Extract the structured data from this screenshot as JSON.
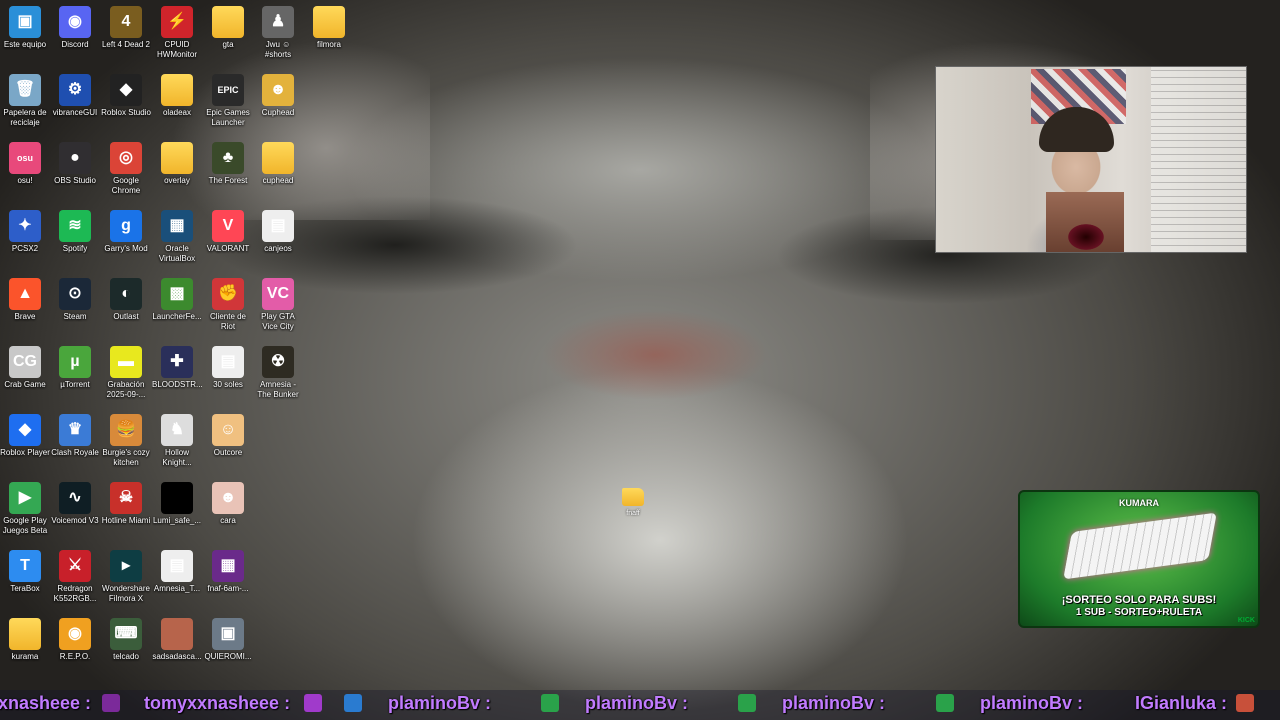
{
  "desktop": {
    "icons": [
      {
        "label": "Este equipo",
        "glyph": "▣",
        "color": "#2a8fd8"
      },
      {
        "label": "Discord",
        "glyph": "◉",
        "color": "#5865f2"
      },
      {
        "label": "Left 4 Dead 2",
        "glyph": "4",
        "color": "#7a5d1f"
      },
      {
        "label": "CPUID HWMonitor",
        "glyph": "⚡",
        "color": "#d0242b"
      },
      {
        "label": "gta",
        "glyph": "",
        "color": "folder"
      },
      {
        "label": "Jwu ☺ #shorts",
        "glyph": "♟",
        "color": "#666"
      },
      {
        "label": "filmora",
        "glyph": "",
        "color": "folder"
      },
      {
        "label": "Papelera de reciclaje",
        "glyph": "🗑",
        "color": "#7aa7c7"
      },
      {
        "label": "vibranceGUI",
        "glyph": "⚙",
        "color": "#1f4fb0"
      },
      {
        "label": "Roblox Studio",
        "glyph": "◆",
        "color": "#222"
      },
      {
        "label": "oladeax",
        "glyph": "",
        "color": "folder"
      },
      {
        "label": "Epic Games Launcher",
        "glyph": "EPIC",
        "color": "#2a2a2a"
      },
      {
        "label": "Cuphead",
        "glyph": "☻",
        "color": "#e3b23c"
      },
      {
        "label": "osu!",
        "glyph": "osu",
        "color": "#e8497b"
      },
      {
        "label": "OBS Studio",
        "glyph": "●",
        "color": "#302e31"
      },
      {
        "label": "Google Chrome",
        "glyph": "◎",
        "color": "#db4437"
      },
      {
        "label": "overlay",
        "glyph": "",
        "color": "folder"
      },
      {
        "label": "The Forest",
        "glyph": "♣",
        "color": "#3a4a2a"
      },
      {
        "label": "cuphead",
        "glyph": "",
        "color": "folder"
      },
      {
        "label": "PCSX2",
        "glyph": "✦",
        "color": "#2d5ec9"
      },
      {
        "label": "Spotify",
        "glyph": "≋",
        "color": "#1db954"
      },
      {
        "label": "Garry's Mod",
        "glyph": "g",
        "color": "#1a73e8"
      },
      {
        "label": "Oracle VirtualBox",
        "glyph": "▦",
        "color": "#1a4f7a"
      },
      {
        "label": "VALORANT",
        "glyph": "V",
        "color": "#ff4655"
      },
      {
        "label": "canjeos",
        "glyph": "▤",
        "color": "#eeeeee"
      },
      {
        "label": "Brave",
        "glyph": "▲",
        "color": "#fb542b"
      },
      {
        "label": "Steam",
        "glyph": "⊙",
        "color": "#1b2838"
      },
      {
        "label": "Outlast",
        "glyph": "◐",
        "color": "#1c2a2a"
      },
      {
        "label": "LauncherFe...",
        "glyph": "▩",
        "color": "#3c8a2e"
      },
      {
        "label": "Cliente de Riot",
        "glyph": "✊",
        "color": "#d13639"
      },
      {
        "label": "Play GTA Vice City",
        "glyph": "VC",
        "color": "#e35ca8"
      },
      {
        "label": "Crab Game",
        "glyph": "CG",
        "color": "#c8c8c8"
      },
      {
        "label": "µTorrent",
        "glyph": "µ",
        "color": "#4aa63c"
      },
      {
        "label": "Grabación 2025-09-...",
        "glyph": "▬",
        "color": "#e8e81e"
      },
      {
        "label": "BLOODSTR...",
        "glyph": "✚",
        "color": "#2a2f5a"
      },
      {
        "label": "30 soles",
        "glyph": "▤",
        "color": "#eeeeee"
      },
      {
        "label": "Amnesia - The Bunker",
        "glyph": "☢",
        "color": "#2e2b22"
      },
      {
        "label": "Roblox Player",
        "glyph": "◆",
        "color": "#1e6ef0"
      },
      {
        "label": "Clash Royale",
        "glyph": "♛",
        "color": "#3b7bd6"
      },
      {
        "label": "Burgie's cozy kitchen",
        "glyph": "🍔",
        "color": "#d88a3a"
      },
      {
        "label": "Hollow Knight...",
        "glyph": "♞",
        "color": "#ddd"
      },
      {
        "label": "Outcore",
        "glyph": "☺",
        "color": "#f0c080"
      },
      {
        "label": "Google Play Juegos Beta",
        "glyph": "▶",
        "color": "#34a853"
      },
      {
        "label": "Voicemod V3",
        "glyph": "∿",
        "color": "#0f1e24"
      },
      {
        "label": "Hotline Miami",
        "glyph": "☠",
        "color": "#c8302a"
      },
      {
        "label": "Lumi_safe_...",
        "glyph": "",
        "color": "#000000"
      },
      {
        "label": "cara",
        "glyph": "☻",
        "color": "#e9c3b7"
      },
      {
        "label": "TeraBox",
        "glyph": "T",
        "color": "#2d8cf0"
      },
      {
        "label": "Redragon K552RGB...",
        "glyph": "⚔",
        "color": "#c8202a"
      },
      {
        "label": "Wondershare Filmora X",
        "glyph": "▸",
        "color": "#0e3d43"
      },
      {
        "label": "Amnesia_T...",
        "glyph": "▤",
        "color": "#eeeeee"
      },
      {
        "label": "fnaf-6am-...",
        "glyph": "▦",
        "color": "#6a2a8a"
      },
      {
        "label": "kurama",
        "glyph": "",
        "color": "folder"
      },
      {
        "label": "R.E.P.O.",
        "glyph": "◉",
        "color": "#f0a020"
      },
      {
        "label": "telcado",
        "glyph": "⌨",
        "color": "#3b5d3b"
      },
      {
        "label": "sadsadasca...",
        "glyph": "",
        "color": "#b7644b"
      },
      {
        "label": "QUIEROMI...",
        "glyph": "▣",
        "color": "#6c7a88"
      }
    ],
    "center_folder": {
      "label": "fnaff"
    }
  },
  "ad": {
    "brand": "KUMARA",
    "line1": "¡SORTEO SOLO PARA SUBS!",
    "line2": "1 SUB - SORTEO+RULETA",
    "corner": "KICK"
  },
  "ticker": {
    "items": [
      {
        "text": "xnasheee :"
      },
      {
        "text": "tomyxxnasheee :"
      },
      {
        "text": "plaminoBv :"
      },
      {
        "text": "plaminoBv :"
      },
      {
        "text": "plaminoBv :"
      },
      {
        "text": "plaminoBv :"
      },
      {
        "text": "IGianluka :"
      }
    ]
  }
}
